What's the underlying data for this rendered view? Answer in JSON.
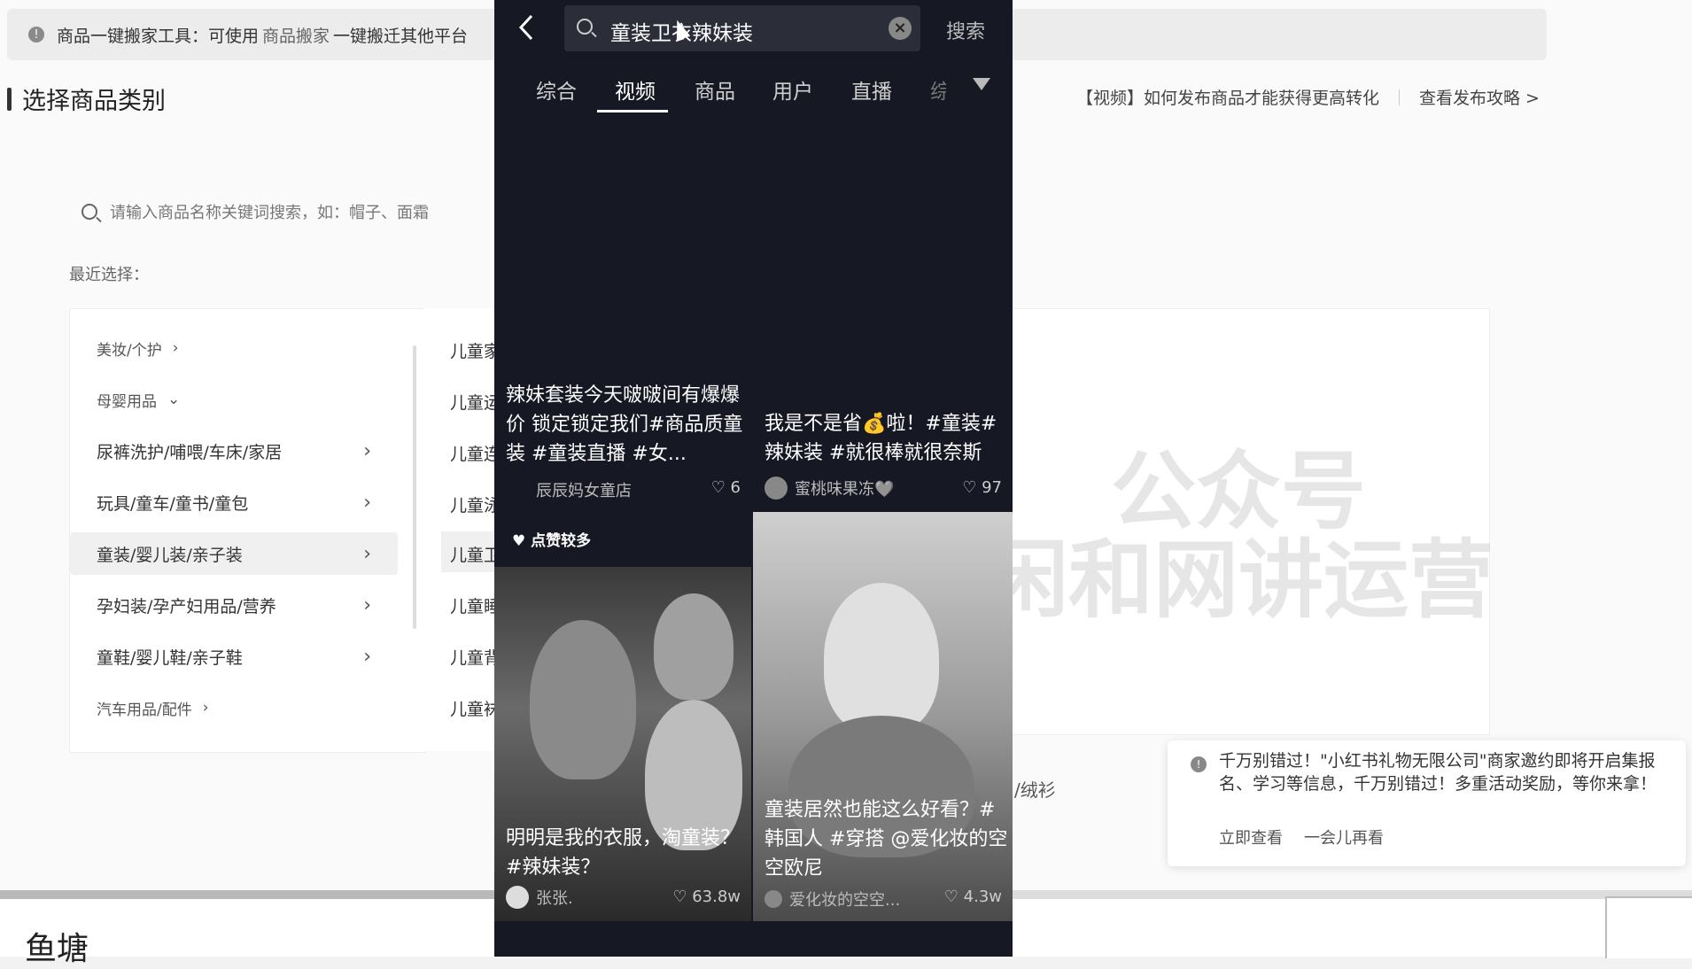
{
  "top_notice": {
    "title": "商品一键搬家工具：可使用",
    "link": "商品搬家",
    "text": "一键搬迁其他平台"
  },
  "page": {
    "section_title": "选择商品类别",
    "guide_link": "【视频】如何发布商品才能获得更高转化",
    "guide_more": "查看发布攻略 >",
    "search_placeholder": "请输入商品名称关键词搜索，如：帽子、面霜",
    "recent_label": "最近选择："
  },
  "categories": [
    {
      "label": "美妆/个护",
      "arrow": "›"
    },
    {
      "label": "母婴用品",
      "arrow": "⌄"
    },
    {
      "label": "尿裤洗护/哺喂/车床/家居",
      "arrow": "›"
    },
    {
      "label": "玩具/童车/童书/童包",
      "arrow": "›"
    },
    {
      "label": "童装/婴儿装/亲子装",
      "arrow": "›"
    },
    {
      "label": "孕妇装/孕产妇用品/营养",
      "arrow": "›"
    },
    {
      "label": "童鞋/婴儿鞋/亲子鞋",
      "arrow": "›"
    },
    {
      "label": "汽车用品/配件",
      "arrow": "›"
    }
  ],
  "subcategories": [
    "儿童家",
    "儿童运",
    "儿童连",
    "儿童泳",
    "儿童卫",
    "儿童睡",
    "儿童背",
    "儿童袜"
  ],
  "right_partial_text": "/绒衫",
  "bottom_title": "鱼塘",
  "watermark": {
    "line1": "公众号",
    "line2": "闲和网讲运营"
  },
  "toast": {
    "message": "千万别错过！\"小红书礼物无限公司\"商家邀约即将开启集报名、学习等信息，千万别错过！多重活动奖励，等你来拿！",
    "action_primary": "立即查看",
    "action_secondary": "一会儿再看"
  },
  "phone": {
    "search_query": "童装卫衣辣妹装",
    "search_button": "搜索",
    "tabs": [
      "综合",
      "视频",
      "商品",
      "用户",
      "直播",
      "综"
    ],
    "active_tab": "视频",
    "hot_badge": "点赞较多",
    "cards": [
      {
        "caption": "辣妹套装今天啵啵间有爆爆价 锁定锁定我们#商品质童装 #童装直播 #女...",
        "author": "辰辰妈女童店",
        "likes": "6"
      },
      {
        "caption": "我是不是省💰啦！#童装#辣妹装 #就很棒就很奈斯",
        "author": "蜜桃味果冻🩶",
        "likes": "97"
      },
      {
        "caption": "明明是我的衣服，淘童装？ #辣妹装？",
        "author": "张张.",
        "likes": "63.8w"
      },
      {
        "caption": "童装居然也能这么好看？#韩国人 #穿搭 @爱化妆的空空欧尼",
        "author": "爱化妆的空空...",
        "likes": "4.3w"
      }
    ]
  },
  "colors": {
    "phone_bg": "#161823",
    "page_bg": "#fafafa"
  }
}
